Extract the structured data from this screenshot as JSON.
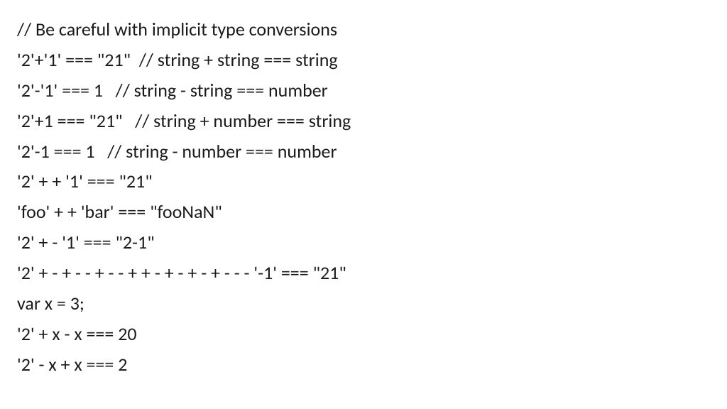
{
  "lines": {
    "l0": "// Be careful with implicit type conversions",
    "l1": "'2'+'1' === \"21\"  // string + string === string",
    "l2": "'2'-'1' === 1   // string - string === number",
    "l3": "'2'+1 === \"21\"   // string + number === string",
    "l4": "'2'-1 === 1   // string - number === number",
    "l5": "'2' + + '1' === \"21\"",
    "l6": "'foo' + + 'bar' === \"fooNaN\"",
    "l7": "'2' + - '1' === \"2-1\"",
    "l8": "'2' + - + - - + - - + + - + - + - + - - - '-1' === \"21\"",
    "l9": "var x = 3;",
    "l10": "'2' + x - x === 20",
    "l11": "'2' - x + x === 2"
  }
}
